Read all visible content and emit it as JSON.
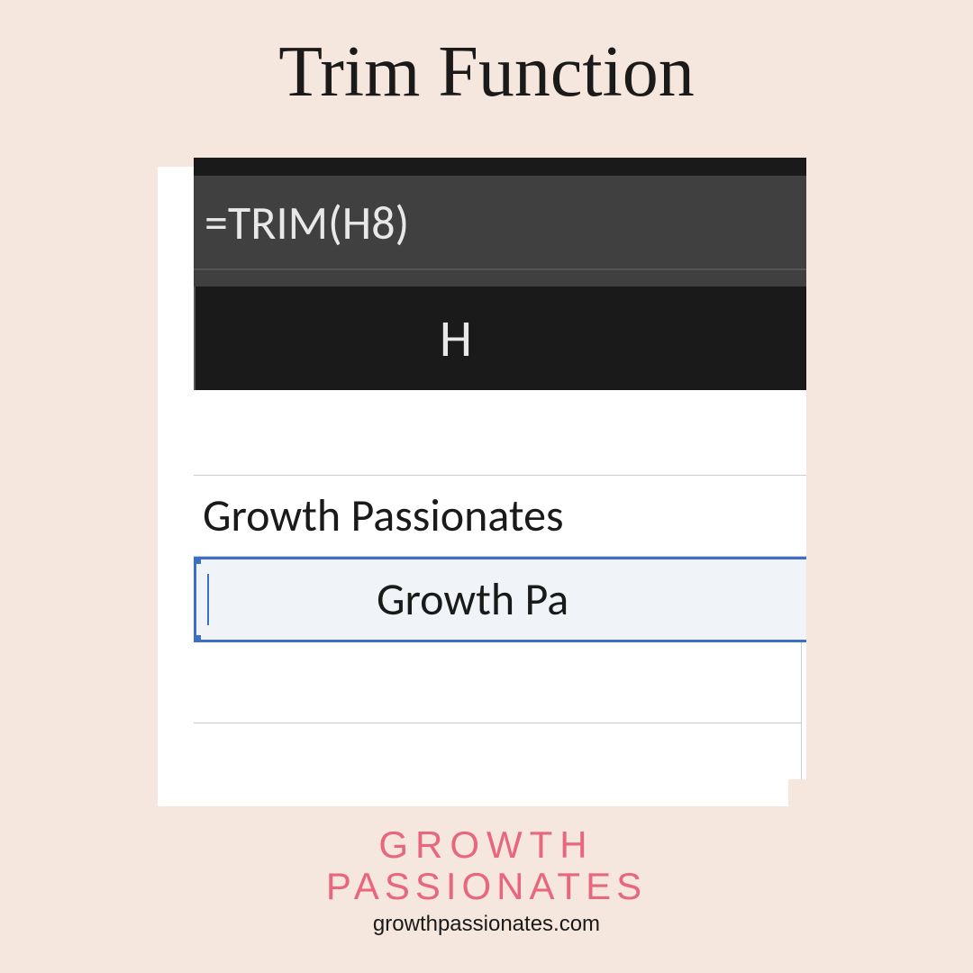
{
  "title": "Trim Function",
  "spreadsheet": {
    "formula": "=TRIM(H8)",
    "column_header": "H",
    "cell_value_1": "Growth Passionates",
    "selected_cell_value": "Growth Pa"
  },
  "footer": {
    "logo_line1": "GROWTH",
    "logo_line2": "PASSIONATES",
    "url": "growthpassionates.com"
  }
}
